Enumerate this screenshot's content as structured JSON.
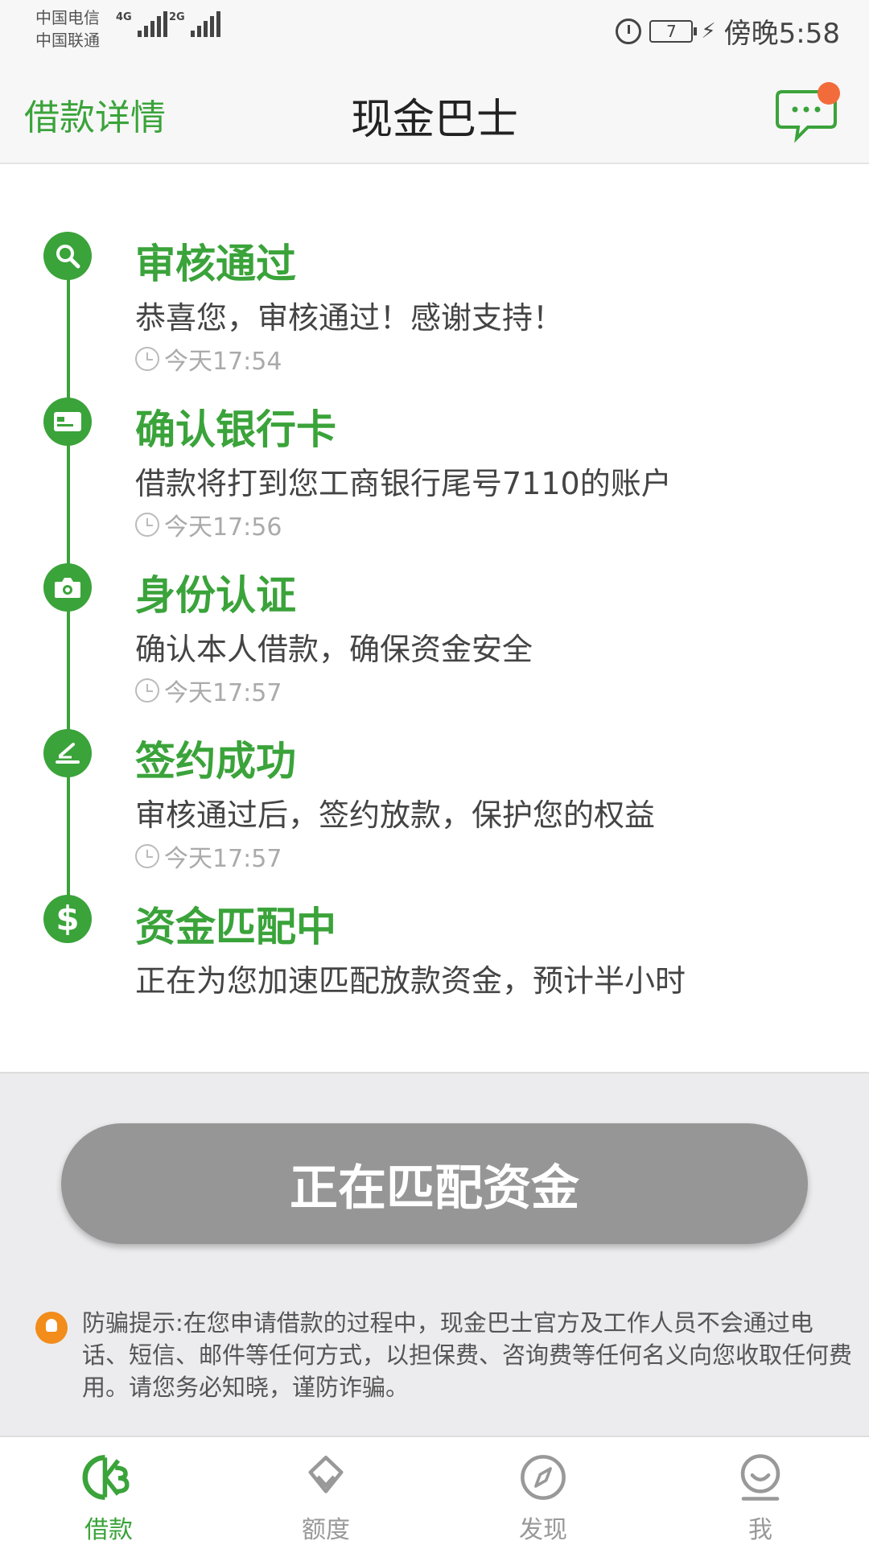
{
  "status_bar": {
    "carrier1": "中国电信",
    "carrier2": "中国联通",
    "net1": "4G",
    "net2": "2G",
    "battery": "7",
    "time": "傍晚5:58"
  },
  "header": {
    "back_title": "借款详情",
    "app_title": "现金巴士",
    "chat_icon": "chat-bubble-icon"
  },
  "timeline": {
    "steps": [
      {
        "icon": "search-icon",
        "title": "审核通过",
        "desc": "恭喜您，审核通过！感谢支持！",
        "time": "今天17:54"
      },
      {
        "icon": "bank-card-icon",
        "title": "确认银行卡",
        "desc": "借款将打到您工商银行尾号7110的账户",
        "time": "今天17:56"
      },
      {
        "icon": "camera-icon",
        "title": "身份认证",
        "desc": "确认本人借款，确保资金安全",
        "time": "今天17:57"
      },
      {
        "icon": "sign-icon",
        "title": "签约成功",
        "desc": "审核通过后，签约放款，保护您的权益",
        "time": "今天17:57"
      },
      {
        "icon": "dollar-icon",
        "title": "资金匹配中",
        "desc": "正在为您加速匹配放款资金，预计半小时"
      }
    ]
  },
  "main_button": {
    "label": "正在匹配资金"
  },
  "notice": {
    "text": "防骗提示:在您申请借款的过程中，现金巴士官方及工作人员不会通过电话、短信、邮件等任何方式，以担保费、咨询费等任何名义向您收取任何费用。请您务必知晓，谨防诈骗。"
  },
  "tabs": [
    {
      "label": "借款",
      "icon": "loan-icon",
      "active": true
    },
    {
      "label": "额度",
      "icon": "diamond-icon",
      "active": false
    },
    {
      "label": "发现",
      "icon": "compass-icon",
      "active": false
    },
    {
      "label": "我",
      "icon": "smiley-icon",
      "active": false
    }
  ],
  "colors": {
    "accent": "#3aa33a",
    "badge": "#f26b3a",
    "button": "#969696",
    "notice_icon": "#f28c1a"
  }
}
